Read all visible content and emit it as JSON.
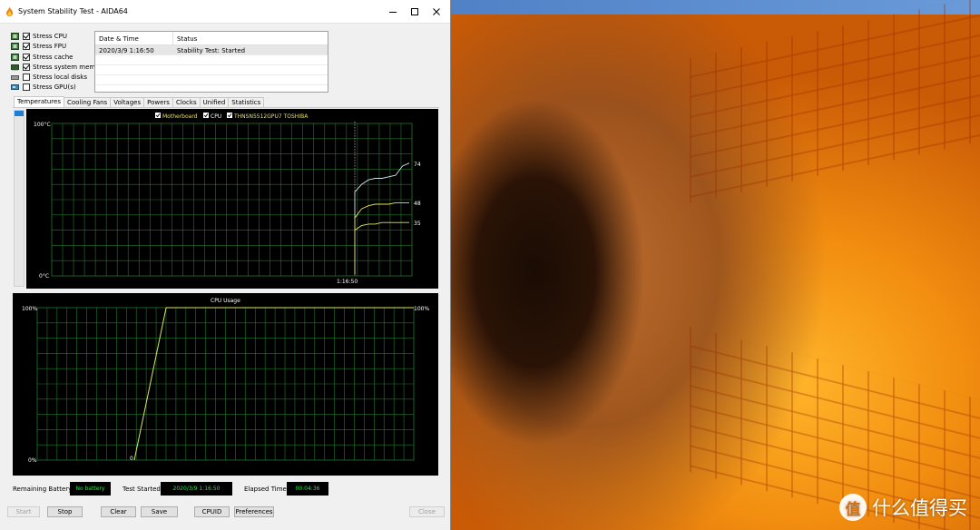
{
  "window": {
    "title": "System Stability Test - AIDA64"
  },
  "stress_options": [
    {
      "label": "Stress CPU",
      "checked": true,
      "icon": "cpu-icon"
    },
    {
      "label": "Stress FPU",
      "checked": true,
      "icon": "fpu-icon"
    },
    {
      "label": "Stress cache",
      "checked": true,
      "icon": "cache-icon"
    },
    {
      "label": "Stress system memory",
      "checked": true,
      "icon": "memory-icon"
    },
    {
      "label": "Stress local disks",
      "checked": false,
      "icon": "disk-icon"
    },
    {
      "label": "Stress GPU(s)",
      "checked": false,
      "icon": "gpu-icon"
    }
  ],
  "log": {
    "columns": [
      "Date & Time",
      "Status"
    ],
    "rows": [
      {
        "datetime": "2020/3/9 1:16:50",
        "status": "Stability Test: Started"
      }
    ]
  },
  "tabs": [
    "Temperatures",
    "Cooling Fans",
    "Voltages",
    "Powers",
    "Clocks",
    "Unified",
    "Statistics"
  ],
  "active_tab": "Temperatures",
  "temperature_graph": {
    "legend": [
      {
        "label": "Motherboard",
        "checked": true,
        "color": "#e8e060"
      },
      {
        "label": "CPU",
        "checked": true,
        "color": "#ffffff"
      },
      {
        "label": "THNSN5512GPU7 TOSHIBA",
        "checked": true,
        "color": "#e8e060"
      }
    ],
    "y_top_label": "100°C",
    "y_bottom_label": "0°C",
    "x_marker_label": "1:16:50",
    "value_labels": [
      "74",
      "48",
      "35"
    ]
  },
  "cpu_graph": {
    "title": "CPU Usage",
    "y_top_label": "100%",
    "y_bottom_label": "0%",
    "right_value_label": "100%",
    "start_value_label": "0"
  },
  "chart_data": [
    {
      "type": "line",
      "title": "",
      "xlabel": "",
      "ylabel": "",
      "ylim": [
        0,
        100
      ],
      "grid": true,
      "legend_placement": "top-center",
      "x_tick_labels": [
        "1:16:50"
      ],
      "series": [
        {
          "name": "CPU",
          "color": "#cfe8f0",
          "values": [
            55,
            60,
            63,
            64,
            64,
            65,
            66,
            72,
            74
          ]
        },
        {
          "name": "THNSN5512GPU7 TOSHIBA",
          "color": "#e8e060",
          "values": [
            38,
            44,
            46,
            47,
            47,
            47,
            48,
            48,
            48
          ]
        },
        {
          "name": "Motherboard",
          "color": "#e8e060",
          "values": [
            30,
            33,
            34,
            34,
            35,
            35,
            35,
            35,
            35
          ]
        }
      ]
    },
    {
      "type": "line",
      "title": "CPU Usage",
      "xlabel": "",
      "ylabel": "",
      "ylim": [
        0,
        100
      ],
      "grid": true,
      "series": [
        {
          "color": "#d8e860",
          "values": [
            0,
            100,
            100,
            100,
            100,
            100,
            100,
            100,
            100,
            100
          ]
        }
      ]
    }
  ],
  "status_bar": {
    "remaining_battery_label": "Remaining Battery:",
    "remaining_battery_value": "No battery",
    "test_started_label": "Test Started:",
    "test_started_value": "2020/3/9 1:16:50",
    "elapsed_time_label": "Elapsed Time:",
    "elapsed_time_value": "00:04:36"
  },
  "buttons": {
    "start": "Start",
    "stop": "Stop",
    "clear": "Clear",
    "save": "Save",
    "cpuid": "CPUID",
    "preferences": "Preferences",
    "close": "Close"
  },
  "watermark": {
    "logo_char": "值",
    "text": "什么值得买"
  },
  "colors": {
    "grid": "#1f7a2a",
    "status_text": "#2fe04a",
    "selection_blue": "#1e7fd6"
  }
}
